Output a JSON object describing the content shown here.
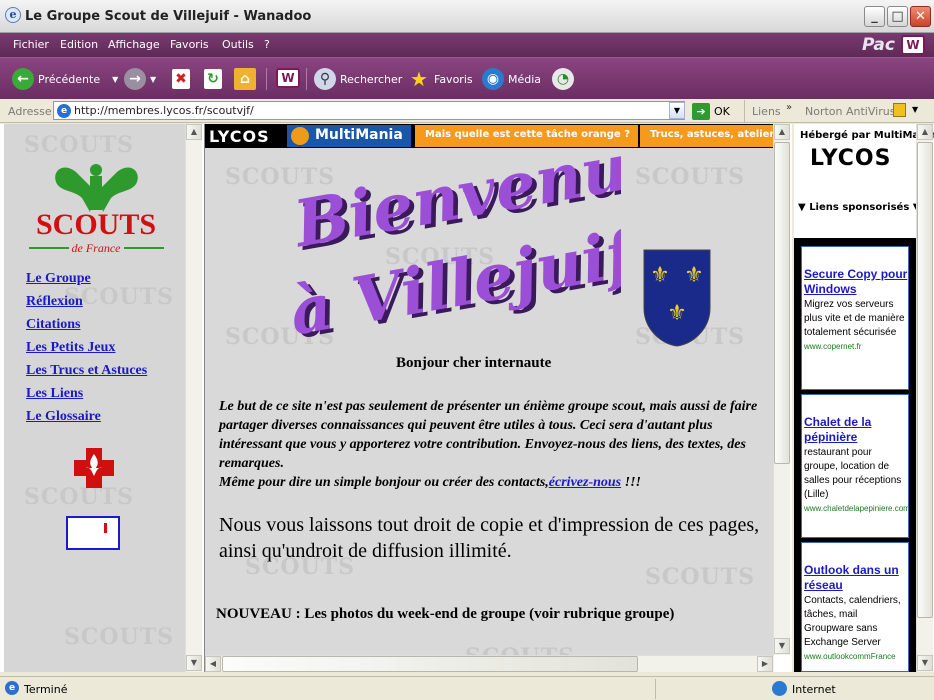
{
  "window": {
    "title": "Le Groupe Scout de Villejuif - Wanadoo"
  },
  "menu": {
    "items": [
      "Fichier",
      "Edition",
      "Affichage",
      "Favoris",
      "Outils",
      "?"
    ],
    "brand": "Pac"
  },
  "toolbar": {
    "back": "Précédente",
    "search": "Rechercher",
    "favorites": "Favoris",
    "media": "Média"
  },
  "address": {
    "label": "Adresse",
    "url": "http://membres.lycos.fr/scoutvjf/",
    "go": "OK",
    "links": "Liens",
    "antivirus": "Norton AntiVirus"
  },
  "left": {
    "logo_text": "SCOUTS",
    "logo_sub": "de France",
    "nav": [
      "Le Groupe",
      "Réflexion",
      "Citations",
      "Les Petits Jeux",
      "Les Trucs et Astuces",
      "Les Liens",
      "Le Glossaire"
    ]
  },
  "banner": {
    "lycos": "LYCOS",
    "multimania": "MultiMania",
    "tab1": "Mais quelle est cette tâche orange ?",
    "tab2": "Trucs, astuces, atelier"
  },
  "main": {
    "title_line1": "Bienvenue",
    "title_line2": "à Villejuif",
    "greeting": "Bonjour cher internaute",
    "intro": "Le but de ce site n'est pas seulement de présenter un énième groupe scout, mais aussi de faire partager diverses connaissances qui peuvent être utiles à tous. Ceci sera d'autant plus intéressant que vous y apporterez votre contribution. Envoyez-nous des liens, des textes, des remarques.",
    "contact_prefix": "Même pour dire un simple bonjour ou créer des contacts,",
    "contact_link": "écrivez-nous",
    "contact_suffix": " !!!",
    "copyright": "Nous vous laissons tout droit de copie et d'impression de ces pages, ainsi qu'undroit de diffusion illimité.",
    "nouveau": "NOUVEAU : Les photos du week-end de groupe (voir rubrique groupe)"
  },
  "right": {
    "hosted": "Hébergé par MultiMania",
    "lycos": "LYCOS",
    "sponsored": "Liens sponsorisés",
    "ads": [
      {
        "title": "Secure Copy pour Windows",
        "body": "Migrez vos serveurs plus vite et de manière totalement sécurisée",
        "url": "www.copernet.fr"
      },
      {
        "title": "Chalet de la pépinière",
        "body": "restaurant pour groupe, location de salles pour réceptions (Lille)",
        "url": "www.chaletdelapepiniere.com"
      },
      {
        "title": "Outlook dans un réseau",
        "body": "Contacts, calendriers, tâches, mail Groupware sans Exchange Server",
        "url": "www.outlookcommFrance"
      }
    ]
  },
  "status": {
    "text": "Terminé",
    "zone": "Internet"
  },
  "colors": {
    "toolbar": "#7a3a70",
    "link": "#1a1ac8",
    "title_purple": "#9b4fd6",
    "orange": "#f59a1c"
  }
}
